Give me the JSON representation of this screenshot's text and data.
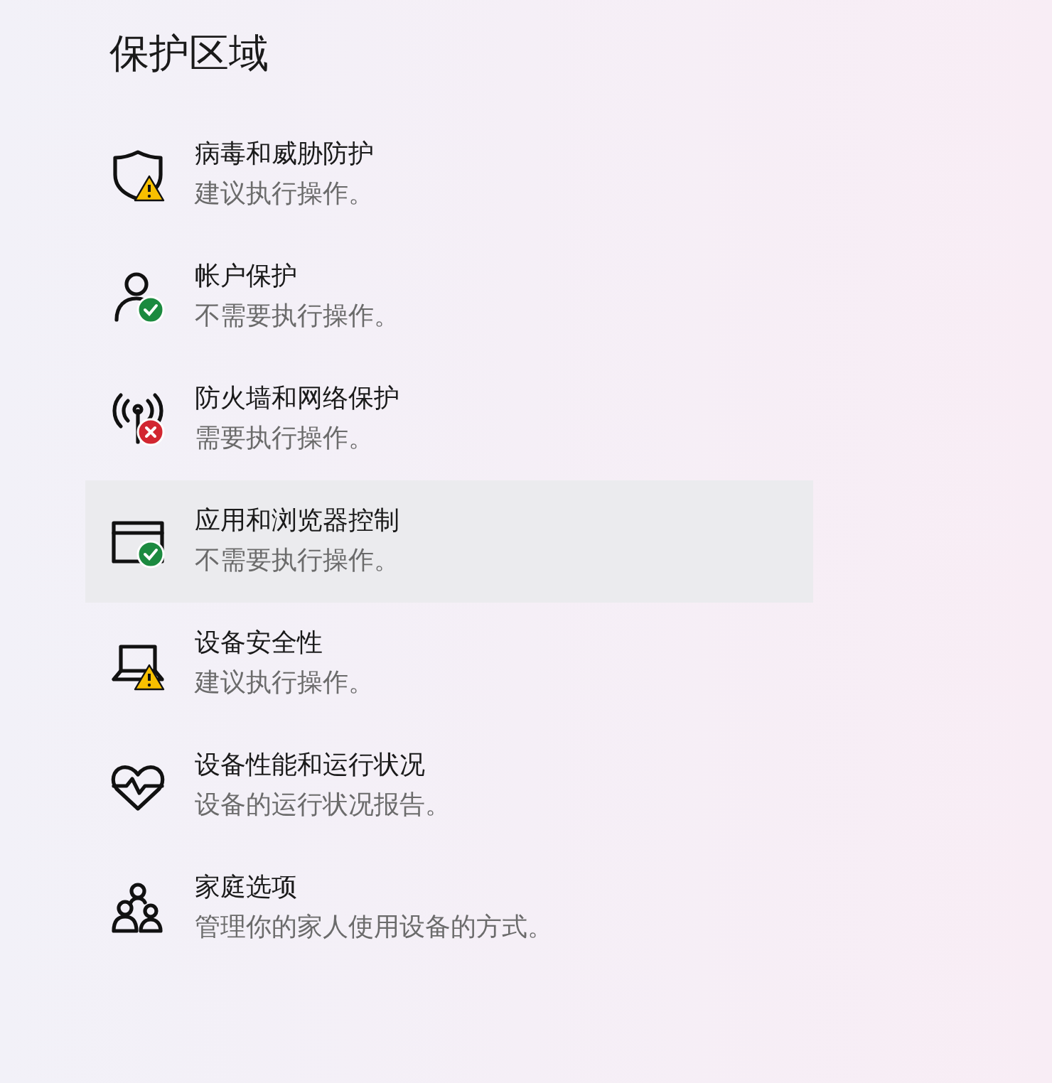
{
  "title": "保护区域",
  "items": [
    {
      "kind": "shield",
      "badge": {
        "kind": "warning"
      },
      "title": "病毒和威胁防护",
      "subtitle": "建议执行操作。",
      "selected": false
    },
    {
      "kind": "person",
      "badge": {
        "kind": "ok"
      },
      "title": "帐户保护",
      "subtitle": "不需要执行操作。",
      "selected": false
    },
    {
      "kind": "antenna",
      "badge": {
        "kind": "error"
      },
      "title": "防火墙和网络保护",
      "subtitle": "需要执行操作。",
      "selected": false
    },
    {
      "kind": "browser",
      "badge": {
        "kind": "ok"
      },
      "title": "应用和浏览器控制",
      "subtitle": "不需要执行操作。",
      "selected": true
    },
    {
      "kind": "laptop",
      "badge": {
        "kind": "warning"
      },
      "title": "设备安全性",
      "subtitle": "建议执行操作。",
      "selected": false
    },
    {
      "kind": "heart",
      "title": "设备性能和运行状况",
      "subtitle": "设备的运行状况报告。",
      "selected": false
    },
    {
      "kind": "family",
      "title": "家庭选项",
      "subtitle": "管理你的家人使用设备的方式。",
      "selected": false
    }
  ]
}
